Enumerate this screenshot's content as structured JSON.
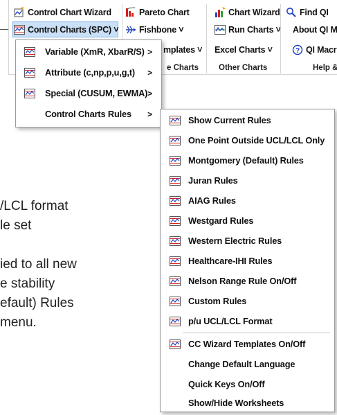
{
  "ribbon": {
    "col1": {
      "wizard": "Control Chart Wizard",
      "spc": "Control Charts (SPC) ˅"
    },
    "col2": {
      "pareto": "Pareto Chart",
      "fishbone": "Fishbone ˅",
      "templates": "mplates ˅",
      "group": "e Charts"
    },
    "col3": {
      "wizard": "Chart Wizard",
      "run": "Run Charts ˅",
      "excel": "Excel Charts ˅",
      "group": "Other Charts"
    },
    "col4": {
      "find": "Find QI",
      "about": "About QI M",
      "macro": "QI Macr",
      "group": "Help &"
    }
  },
  "background_text": {
    "line1": "/LCL format",
    "line2": "le set",
    "line3": "ied to all new",
    "line4": "e stability",
    "line5": "efault) Rules",
    "line6": " menu."
  },
  "submenu_spc": {
    "items": [
      {
        "label": "Variable (XmR, XbarR/S)",
        "arrow": ">"
      },
      {
        "label": "Attribute (c,np,p,u,g,t)",
        "arrow": ">"
      },
      {
        "label": "Special (CUSUM, EWMA)",
        "arrow": ">"
      },
      {
        "label": "Control Charts Rules",
        "arrow": ">"
      }
    ]
  },
  "submenu_rules": {
    "items": [
      {
        "label": "Show Current Rules"
      },
      {
        "label": "One Point Outside UCL/LCL Only"
      },
      {
        "label": "Montgomery (Default) Rules"
      },
      {
        "label": "Juran Rules"
      },
      {
        "label": "AIAG Rules"
      },
      {
        "label": "Westgard Rules"
      },
      {
        "label": "Western Electric Rules"
      },
      {
        "label": "Healthcare-IHI Rules"
      },
      {
        "label": "Nelson Range Rule On/Off"
      },
      {
        "label": "Custom Rules"
      },
      {
        "label": "p/u UCL/LCL Format"
      },
      {
        "label": "CC Wizard Templates On/Off"
      },
      {
        "label": "Change Default Language"
      },
      {
        "label": "Quick Keys On/Off"
      },
      {
        "label": "Show/Hide Worksheets"
      }
    ]
  },
  "colors": {
    "selected_bg": "#c9e0f7",
    "selected_border": "#7fb1e6",
    "icon_line": "#1f3fbf",
    "icon_red": "#d62020"
  },
  "icons": {
    "wizard": "wand-icon",
    "pareto": "pareto-chart-icon",
    "fishbone": "fishbone-icon",
    "chart_wizard": "chart-wizard-icon",
    "run": "run-chart-icon",
    "find": "search-icon",
    "macro": "help-icon",
    "menu_item": "control-chart-icon"
  }
}
